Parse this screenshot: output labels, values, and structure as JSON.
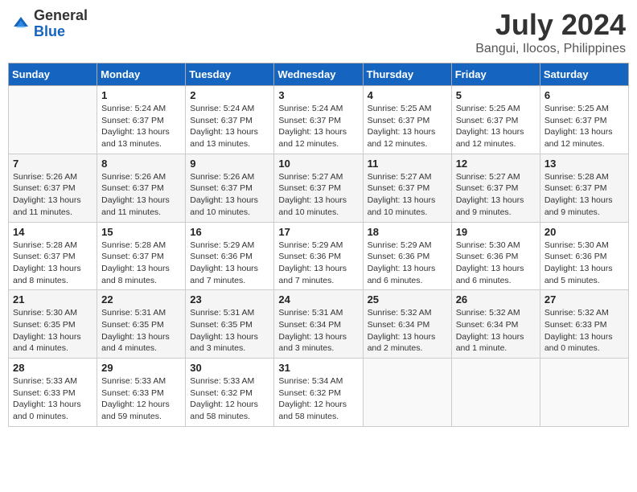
{
  "header": {
    "logo_general": "General",
    "logo_blue": "Blue",
    "month_title": "July 2024",
    "location": "Bangui, Ilocos, Philippines"
  },
  "columns": [
    "Sunday",
    "Monday",
    "Tuesday",
    "Wednesday",
    "Thursday",
    "Friday",
    "Saturday"
  ],
  "weeks": [
    [
      {
        "day": "",
        "sunrise": "",
        "sunset": "",
        "daylight": ""
      },
      {
        "day": "1",
        "sunrise": "5:24 AM",
        "sunset": "6:37 PM",
        "daylight": "13 hours and 13 minutes."
      },
      {
        "day": "2",
        "sunrise": "5:24 AM",
        "sunset": "6:37 PM",
        "daylight": "13 hours and 13 minutes."
      },
      {
        "day": "3",
        "sunrise": "5:24 AM",
        "sunset": "6:37 PM",
        "daylight": "13 hours and 12 minutes."
      },
      {
        "day": "4",
        "sunrise": "5:25 AM",
        "sunset": "6:37 PM",
        "daylight": "13 hours and 12 minutes."
      },
      {
        "day": "5",
        "sunrise": "5:25 AM",
        "sunset": "6:37 PM",
        "daylight": "13 hours and 12 minutes."
      },
      {
        "day": "6",
        "sunrise": "5:25 AM",
        "sunset": "6:37 PM",
        "daylight": "13 hours and 12 minutes."
      }
    ],
    [
      {
        "day": "7",
        "sunrise": "5:26 AM",
        "sunset": "6:37 PM",
        "daylight": "13 hours and 11 minutes."
      },
      {
        "day": "8",
        "sunrise": "5:26 AM",
        "sunset": "6:37 PM",
        "daylight": "13 hours and 11 minutes."
      },
      {
        "day": "9",
        "sunrise": "5:26 AM",
        "sunset": "6:37 PM",
        "daylight": "13 hours and 10 minutes."
      },
      {
        "day": "10",
        "sunrise": "5:27 AM",
        "sunset": "6:37 PM",
        "daylight": "13 hours and 10 minutes."
      },
      {
        "day": "11",
        "sunrise": "5:27 AM",
        "sunset": "6:37 PM",
        "daylight": "13 hours and 10 minutes."
      },
      {
        "day": "12",
        "sunrise": "5:27 AM",
        "sunset": "6:37 PM",
        "daylight": "13 hours and 9 minutes."
      },
      {
        "day": "13",
        "sunrise": "5:28 AM",
        "sunset": "6:37 PM",
        "daylight": "13 hours and 9 minutes."
      }
    ],
    [
      {
        "day": "14",
        "sunrise": "5:28 AM",
        "sunset": "6:37 PM",
        "daylight": "13 hours and 8 minutes."
      },
      {
        "day": "15",
        "sunrise": "5:28 AM",
        "sunset": "6:37 PM",
        "daylight": "13 hours and 8 minutes."
      },
      {
        "day": "16",
        "sunrise": "5:29 AM",
        "sunset": "6:36 PM",
        "daylight": "13 hours and 7 minutes."
      },
      {
        "day": "17",
        "sunrise": "5:29 AM",
        "sunset": "6:36 PM",
        "daylight": "13 hours and 7 minutes."
      },
      {
        "day": "18",
        "sunrise": "5:29 AM",
        "sunset": "6:36 PM",
        "daylight": "13 hours and 6 minutes."
      },
      {
        "day": "19",
        "sunrise": "5:30 AM",
        "sunset": "6:36 PM",
        "daylight": "13 hours and 6 minutes."
      },
      {
        "day": "20",
        "sunrise": "5:30 AM",
        "sunset": "6:36 PM",
        "daylight": "13 hours and 5 minutes."
      }
    ],
    [
      {
        "day": "21",
        "sunrise": "5:30 AM",
        "sunset": "6:35 PM",
        "daylight": "13 hours and 4 minutes."
      },
      {
        "day": "22",
        "sunrise": "5:31 AM",
        "sunset": "6:35 PM",
        "daylight": "13 hours and 4 minutes."
      },
      {
        "day": "23",
        "sunrise": "5:31 AM",
        "sunset": "6:35 PM",
        "daylight": "13 hours and 3 minutes."
      },
      {
        "day": "24",
        "sunrise": "5:31 AM",
        "sunset": "6:34 PM",
        "daylight": "13 hours and 3 minutes."
      },
      {
        "day": "25",
        "sunrise": "5:32 AM",
        "sunset": "6:34 PM",
        "daylight": "13 hours and 2 minutes."
      },
      {
        "day": "26",
        "sunrise": "5:32 AM",
        "sunset": "6:34 PM",
        "daylight": "13 hours and 1 minute."
      },
      {
        "day": "27",
        "sunrise": "5:32 AM",
        "sunset": "6:33 PM",
        "daylight": "13 hours and 0 minutes."
      }
    ],
    [
      {
        "day": "28",
        "sunrise": "5:33 AM",
        "sunset": "6:33 PM",
        "daylight": "13 hours and 0 minutes."
      },
      {
        "day": "29",
        "sunrise": "5:33 AM",
        "sunset": "6:33 PM",
        "daylight": "12 hours and 59 minutes."
      },
      {
        "day": "30",
        "sunrise": "5:33 AM",
        "sunset": "6:32 PM",
        "daylight": "12 hours and 58 minutes."
      },
      {
        "day": "31",
        "sunrise": "5:34 AM",
        "sunset": "6:32 PM",
        "daylight": "12 hours and 58 minutes."
      },
      {
        "day": "",
        "sunrise": "",
        "sunset": "",
        "daylight": ""
      },
      {
        "day": "",
        "sunrise": "",
        "sunset": "",
        "daylight": ""
      },
      {
        "day": "",
        "sunrise": "",
        "sunset": "",
        "daylight": ""
      }
    ]
  ]
}
